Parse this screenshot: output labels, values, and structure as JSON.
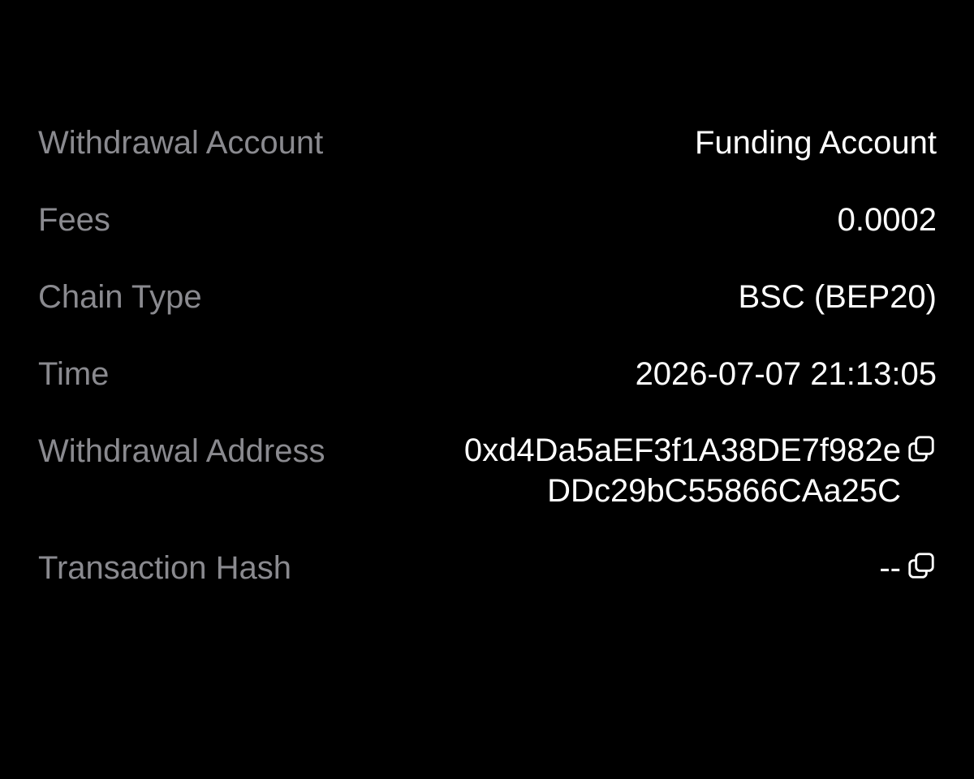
{
  "details": {
    "withdrawal_account": {
      "label": "Withdrawal Account",
      "value": "Funding Account"
    },
    "fees": {
      "label": "Fees",
      "value": "0.0002"
    },
    "chain_type": {
      "label": "Chain Type",
      "value": "BSC (BEP20)"
    },
    "time": {
      "label": "Time",
      "value": "2026-07-07 21:13:05"
    },
    "withdrawal_address": {
      "label": "Withdrawal Address",
      "value_line1": "0xd4Da5aEF3f1A38DE7f982e",
      "value_line2": "DDc29bC55866CAa25C",
      "copy_icon": "copy-icon"
    },
    "transaction_hash": {
      "label": "Transaction Hash",
      "value": "--",
      "copy_icon": "copy-icon"
    }
  },
  "colors": {
    "background": "#000000",
    "label": "#8a8a8f",
    "value": "#ffffff"
  }
}
